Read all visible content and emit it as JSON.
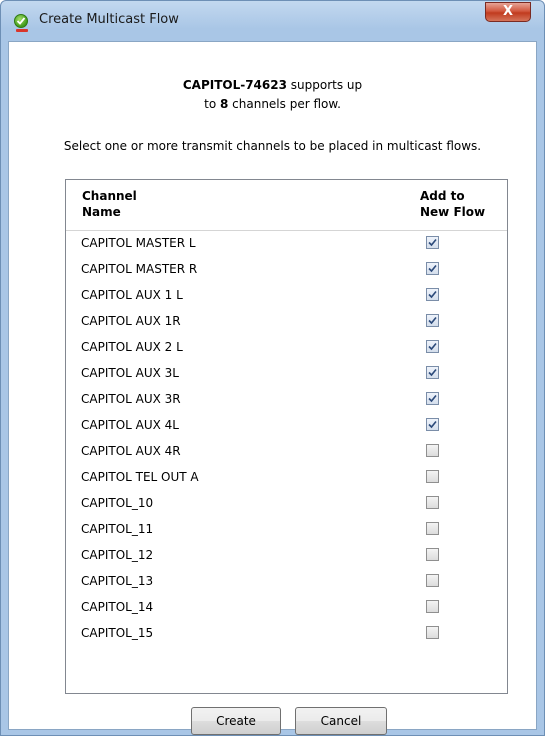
{
  "window": {
    "title": "Create Multicast Flow",
    "close_label": "X"
  },
  "message": {
    "device": "CAPITOL-74623",
    "text1": " supports up",
    "text2_prefix": "to ",
    "max_channels": "8",
    "text2_suffix": " channels per flow."
  },
  "instruction": "Select one or more transmit channels to be placed in multicast flows.",
  "table": {
    "col_name": [
      "Channel",
      "Name"
    ],
    "col_add": [
      "Add to",
      "New Flow"
    ],
    "rows": [
      {
        "name": "CAPITOL MASTER L",
        "checked": true
      },
      {
        "name": "CAPITOL MASTER R",
        "checked": true
      },
      {
        "name": "CAPITOL AUX 1 L",
        "checked": true
      },
      {
        "name": "CAPITOL AUX 1R",
        "checked": true
      },
      {
        "name": "CAPITOL AUX 2 L",
        "checked": true
      },
      {
        "name": "CAPITOL AUX 3L",
        "checked": true
      },
      {
        "name": "CAPITOL AUX 3R",
        "checked": true
      },
      {
        "name": "CAPITOL AUX 4L",
        "checked": true
      },
      {
        "name": "CAPITOL AUX 4R",
        "checked": false
      },
      {
        "name": "CAPITOL TEL OUT A",
        "checked": false
      },
      {
        "name": "CAPITOL_10",
        "checked": false
      },
      {
        "name": "CAPITOL_11",
        "checked": false
      },
      {
        "name": "CAPITOL_12",
        "checked": false
      },
      {
        "name": "CAPITOL_13",
        "checked": false
      },
      {
        "name": "CAPITOL_14",
        "checked": false
      },
      {
        "name": "CAPITOL_15",
        "checked": false
      }
    ]
  },
  "buttons": {
    "create": "Create",
    "cancel": "Cancel"
  }
}
